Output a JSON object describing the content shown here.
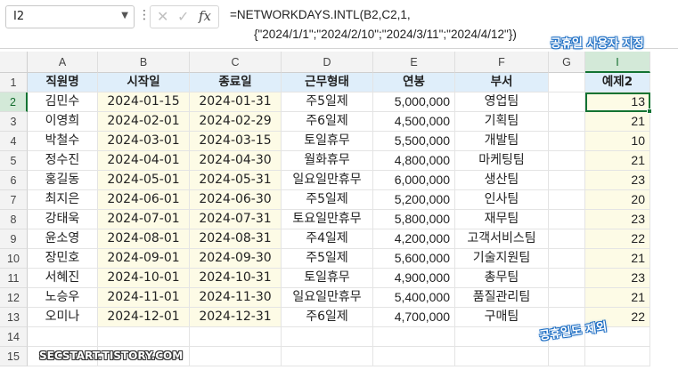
{
  "namebox": {
    "cell": "I2"
  },
  "formula": {
    "line1": "=NETWORKDAYS.INTL(B2,C2,1,",
    "line2": "{\"2024/1/1\";\"2024/2/10\";\"2024/3/11\";\"2024/4/12\"})"
  },
  "annotations": {
    "top": "공휴일 사용자 지정",
    "bottom": "공휴일도 제외",
    "watermark": "SECSTART.TISTORY.COM"
  },
  "columns": [
    "A",
    "B",
    "C",
    "D",
    "E",
    "F",
    "G",
    "I"
  ],
  "rows": [
    "1",
    "2",
    "3",
    "4",
    "5",
    "6",
    "7",
    "8",
    "9",
    "10",
    "11",
    "12",
    "13",
    "14",
    "15"
  ],
  "headers": {
    "A": "직원명",
    "B": "시작일",
    "C": "종료일",
    "D": "근무형태",
    "E": "연봉",
    "F": "부서",
    "I": "예제2"
  },
  "table": [
    {
      "name": "김민수",
      "start": "2024-01-15",
      "end": "2024-01-31",
      "type": "주5일제",
      "salary": "5,000,000",
      "dept": "영업팀",
      "result": "13"
    },
    {
      "name": "이영희",
      "start": "2024-02-01",
      "end": "2024-02-29",
      "type": "주6일제",
      "salary": "4,500,000",
      "dept": "기획팀",
      "result": "21"
    },
    {
      "name": "박철수",
      "start": "2024-03-01",
      "end": "2024-03-15",
      "type": "토일휴무",
      "salary": "5,500,000",
      "dept": "개발팀",
      "result": "10"
    },
    {
      "name": "정수진",
      "start": "2024-04-01",
      "end": "2024-04-30",
      "type": "월화휴무",
      "salary": "4,800,000",
      "dept": "마케팅팀",
      "result": "21"
    },
    {
      "name": "홍길동",
      "start": "2024-05-01",
      "end": "2024-05-31",
      "type": "일요일만휴무",
      "salary": "6,000,000",
      "dept": "생산팀",
      "result": "23"
    },
    {
      "name": "최지은",
      "start": "2024-06-01",
      "end": "2024-06-30",
      "type": "주5일제",
      "salary": "5,200,000",
      "dept": "인사팀",
      "result": "20"
    },
    {
      "name": "강태욱",
      "start": "2024-07-01",
      "end": "2024-07-31",
      "type": "토요일만휴무",
      "salary": "5,800,000",
      "dept": "재무팀",
      "result": "23"
    },
    {
      "name": "윤소영",
      "start": "2024-08-01",
      "end": "2024-08-31",
      "type": "주4일제",
      "salary": "4,200,000",
      "dept": "고객서비스팀",
      "result": "22"
    },
    {
      "name": "장민호",
      "start": "2024-09-01",
      "end": "2024-09-30",
      "type": "주5일제",
      "salary": "5,600,000",
      "dept": "기술지원팀",
      "result": "21"
    },
    {
      "name": "서혜진",
      "start": "2024-10-01",
      "end": "2024-10-31",
      "type": "토일휴무",
      "salary": "4,900,000",
      "dept": "총무팀",
      "result": "23"
    },
    {
      "name": "노승우",
      "start": "2024-11-01",
      "end": "2024-11-30",
      "type": "일요일만휴무",
      "salary": "5,400,000",
      "dept": "품질관리팀",
      "result": "21"
    },
    {
      "name": "오미나",
      "start": "2024-12-01",
      "end": "2024-12-31",
      "type": "주6일제",
      "salary": "4,700,000",
      "dept": "구매팀",
      "result": "22"
    }
  ],
  "colors": {
    "header_fill": "#dfeefa",
    "date_fill": "#fdfbe6",
    "selection": "#137333",
    "annotation": "#1f6fc4"
  }
}
